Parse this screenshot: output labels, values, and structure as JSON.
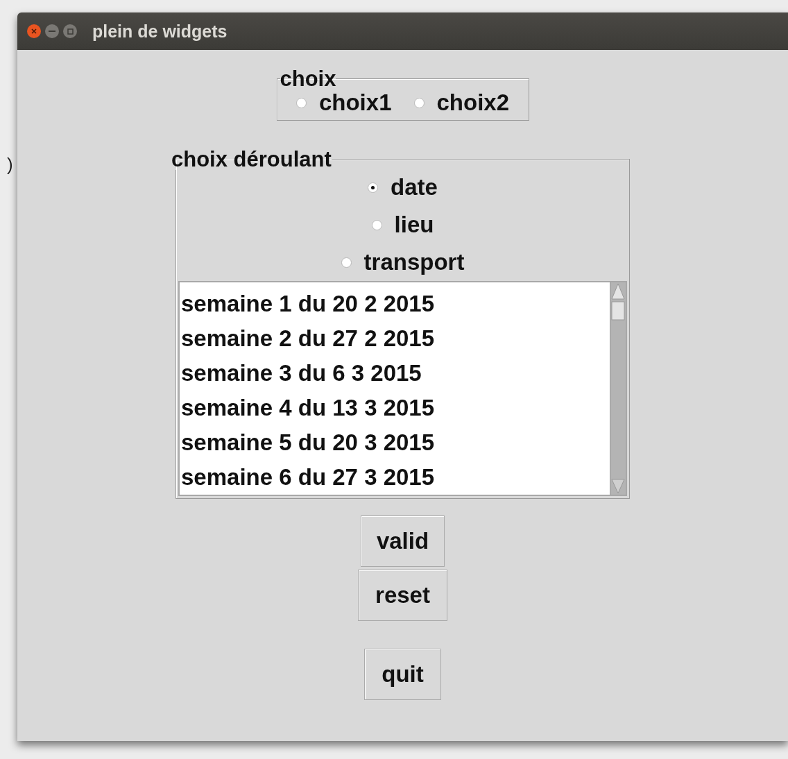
{
  "desktop_text": ")",
  "window": {
    "title": "plein de widgets"
  },
  "choix": {
    "legend": "choix",
    "options": [
      {
        "label": "choix1",
        "selected": false
      },
      {
        "label": "choix2",
        "selected": false
      }
    ]
  },
  "choix_deroulant": {
    "legend": "choix déroulant",
    "options": [
      {
        "label": "date",
        "selected": true
      },
      {
        "label": "lieu",
        "selected": false
      },
      {
        "label": "transport",
        "selected": false
      }
    ],
    "list_items": [
      "semaine 1 du 20 2 2015",
      "semaine 2 du 27 2 2015",
      "semaine 3 du 6 3 2015",
      "semaine 4 du 13 3 2015",
      "semaine 5 du 20 3 2015",
      "semaine 6 du 27 3 2015"
    ]
  },
  "buttons": [
    "valid",
    "reset",
    "quit"
  ]
}
